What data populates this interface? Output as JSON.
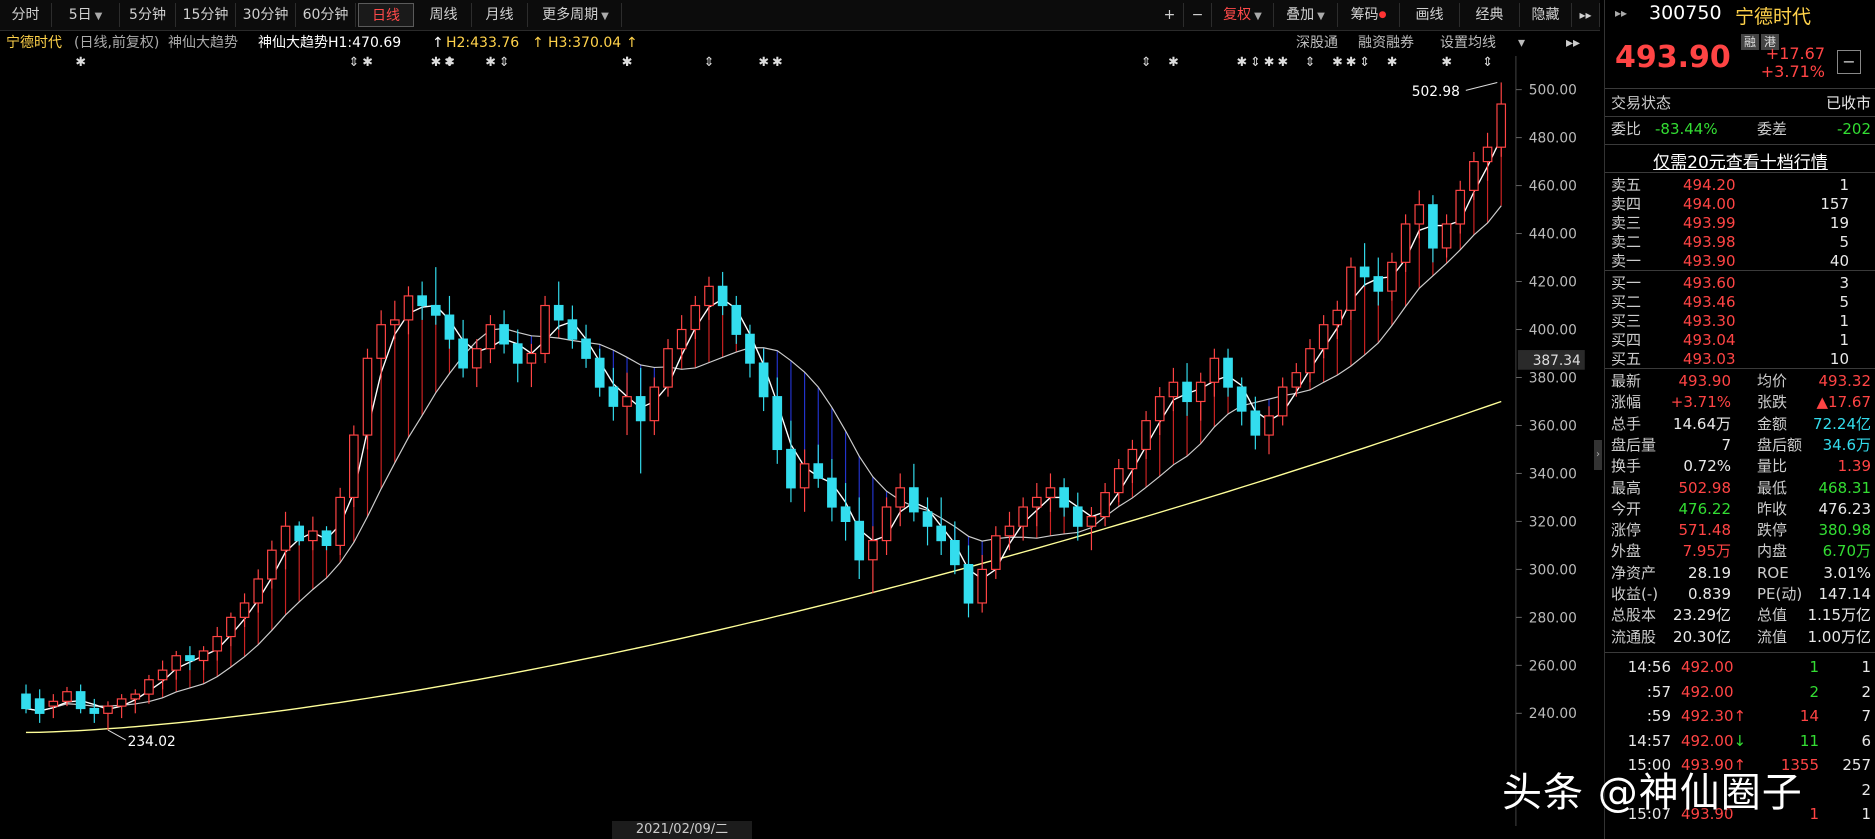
{
  "toolbar": {
    "periods": [
      "分时",
      "5日",
      "5分钟",
      "15分钟",
      "30分钟",
      "60分钟",
      "日线",
      "周线",
      "月线",
      "更多周期"
    ],
    "active_period": "日线",
    "right_buttons": [
      "+",
      "−",
      "复权",
      "叠加",
      "筹码",
      "画线",
      "经典",
      "隐藏"
    ]
  },
  "infobar": {
    "stock_name": "宁德时代",
    "mode": "(日线,前复权)",
    "indicator": "神仙大趋势",
    "h1_label": "神仙大趋势H1:470.69",
    "h2_label": "H2:433.76",
    "h3_label": "H3:370.04",
    "links": [
      "深股通",
      "融资融券",
      "设置均线"
    ]
  },
  "chart": {
    "y_ticks": [
      500.0,
      480.0,
      460.0,
      440.0,
      420.0,
      400.0,
      380.0,
      360.0,
      340.0,
      320.0,
      300.0,
      280.0,
      260.0,
      240.0
    ],
    "current_price_label": "387.34",
    "high_marker": "502.98",
    "low_marker": "234.02",
    "date_label": "2021/02/09/二",
    "colors": {
      "up": "#ff4444",
      "down": "#33ddee",
      "h2": "#ffffff",
      "h3": "#ffff99",
      "band_up": "#cc2222",
      "band_down": "#2233cc"
    }
  },
  "chart_data": {
    "type": "candlestick",
    "ylim": [
      225,
      505
    ],
    "ohlc": [
      [
        248,
        252,
        240,
        242
      ],
      [
        246,
        250,
        236,
        240
      ],
      [
        243,
        248,
        238,
        245
      ],
      [
        245,
        251,
        243,
        249
      ],
      [
        249,
        252,
        240,
        242
      ],
      [
        242,
        246,
        236,
        240
      ],
      [
        240,
        245,
        233,
        243
      ],
      [
        243,
        248,
        238,
        246
      ],
      [
        246,
        250,
        240,
        248
      ],
      [
        248,
        256,
        244,
        254
      ],
      [
        254,
        262,
        250,
        258
      ],
      [
        258,
        266,
        254,
        264
      ],
      [
        264,
        268,
        258,
        262
      ],
      [
        262,
        268,
        258,
        266
      ],
      [
        266,
        276,
        262,
        272
      ],
      [
        272,
        282,
        268,
        280
      ],
      [
        280,
        290,
        276,
        286
      ],
      [
        286,
        300,
        282,
        296
      ],
      [
        296,
        312,
        292,
        308
      ],
      [
        308,
        324,
        300,
        318
      ],
      [
        318,
        320,
        310,
        312
      ],
      [
        312,
        322,
        308,
        316
      ],
      [
        316,
        318,
        308,
        310
      ],
      [
        310,
        334,
        306,
        330
      ],
      [
        330,
        360,
        326,
        356
      ],
      [
        356,
        392,
        350,
        388
      ],
      [
        388,
        408,
        380,
        402
      ],
      [
        402,
        412,
        396,
        404
      ],
      [
        404,
        418,
        398,
        414
      ],
      [
        414,
        420,
        404,
        410
      ],
      [
        410,
        426,
        402,
        406
      ],
      [
        406,
        414,
        392,
        396
      ],
      [
        396,
        404,
        380,
        384
      ],
      [
        384,
        396,
        376,
        392
      ],
      [
        392,
        406,
        386,
        402
      ],
      [
        402,
        408,
        390,
        394
      ],
      [
        394,
        400,
        378,
        386
      ],
      [
        386,
        394,
        376,
        390
      ],
      [
        390,
        414,
        386,
        410
      ],
      [
        410,
        420,
        400,
        404
      ],
      [
        404,
        410,
        392,
        396
      ],
      [
        396,
        402,
        384,
        388
      ],
      [
        388,
        392,
        372,
        376
      ],
      [
        376,
        384,
        362,
        368
      ],
      [
        368,
        382,
        356,
        372
      ],
      [
        372,
        384,
        340,
        362
      ],
      [
        362,
        380,
        356,
        376
      ],
      [
        376,
        396,
        372,
        392
      ],
      [
        392,
        406,
        388,
        400
      ],
      [
        400,
        414,
        396,
        410
      ],
      [
        410,
        422,
        404,
        418
      ],
      [
        418,
        424,
        406,
        410
      ],
      [
        410,
        414,
        394,
        398
      ],
      [
        398,
        402,
        380,
        386
      ],
      [
        386,
        392,
        366,
        372
      ],
      [
        372,
        380,
        344,
        350
      ],
      [
        350,
        362,
        328,
        334
      ],
      [
        334,
        350,
        324,
        344
      ],
      [
        344,
        352,
        334,
        338
      ],
      [
        338,
        346,
        320,
        326
      ],
      [
        326,
        336,
        312,
        320
      ],
      [
        320,
        330,
        296,
        304
      ],
      [
        304,
        318,
        290,
        312
      ],
      [
        312,
        330,
        306,
        326
      ],
      [
        326,
        340,
        318,
        334
      ],
      [
        334,
        344,
        320,
        324
      ],
      [
        324,
        330,
        310,
        318
      ],
      [
        318,
        330,
        306,
        312
      ],
      [
        312,
        320,
        298,
        302
      ],
      [
        302,
        310,
        280,
        286
      ],
      [
        286,
        306,
        282,
        300
      ],
      [
        300,
        318,
        296,
        314
      ],
      [
        314,
        324,
        308,
        318
      ],
      [
        318,
        330,
        312,
        326
      ],
      [
        326,
        336,
        318,
        330
      ],
      [
        330,
        340,
        324,
        334
      ],
      [
        334,
        338,
        322,
        326
      ],
      [
        326,
        332,
        312,
        318
      ],
      [
        318,
        326,
        308,
        322
      ],
      [
        322,
        336,
        318,
        332
      ],
      [
        332,
        346,
        328,
        342
      ],
      [
        342,
        354,
        336,
        350
      ],
      [
        350,
        366,
        346,
        362
      ],
      [
        362,
        376,
        356,
        372
      ],
      [
        372,
        384,
        366,
        378
      ],
      [
        378,
        386,
        364,
        370
      ],
      [
        370,
        382,
        362,
        378
      ],
      [
        378,
        392,
        372,
        388
      ],
      [
        388,
        392,
        372,
        376
      ],
      [
        376,
        380,
        360,
        366
      ],
      [
        366,
        372,
        350,
        356
      ],
      [
        356,
        368,
        348,
        364
      ],
      [
        364,
        380,
        360,
        376
      ],
      [
        376,
        386,
        372,
        382
      ],
      [
        382,
        396,
        378,
        392
      ],
      [
        392,
        406,
        388,
        402
      ],
      [
        402,
        412,
        396,
        408
      ],
      [
        408,
        430,
        404,
        426
      ],
      [
        426,
        436,
        418,
        422
      ],
      [
        422,
        430,
        410,
        416
      ],
      [
        416,
        432,
        412,
        428
      ],
      [
        428,
        448,
        424,
        444
      ],
      [
        444,
        458,
        438,
        452
      ],
      [
        452,
        456,
        428,
        434
      ],
      [
        434,
        448,
        430,
        444
      ],
      [
        444,
        462,
        440,
        458
      ],
      [
        458,
        474,
        454,
        470
      ],
      [
        470,
        482,
        462,
        476
      ],
      [
        476,
        503,
        472,
        494
      ]
    ]
  },
  "panel": {
    "code": "300750",
    "name": "宁德时代",
    "price": "493.90",
    "badges": [
      "融",
      "港"
    ],
    "change": "+17.67",
    "change_pct": "+3.71%",
    "status_label": "交易状态",
    "status_value": "已收市",
    "weibi_label": "委比",
    "weibi_value": "-83.44%",
    "weicha_label": "委差",
    "weicha_value": "-202",
    "promo": "仅需20元查看十档行情",
    "sells": [
      {
        "label": "卖五",
        "price": "494.20",
        "vol": "1"
      },
      {
        "label": "卖四",
        "price": "494.00",
        "vol": "157"
      },
      {
        "label": "卖三",
        "price": "493.99",
        "vol": "19"
      },
      {
        "label": "卖二",
        "price": "493.98",
        "vol": "5"
      },
      {
        "label": "卖一",
        "price": "493.90",
        "vol": "40"
      }
    ],
    "buys": [
      {
        "label": "买一",
        "price": "493.60",
        "vol": "3"
      },
      {
        "label": "买二",
        "price": "493.46",
        "vol": "5"
      },
      {
        "label": "买三",
        "price": "493.30",
        "vol": "1"
      },
      {
        "label": "买四",
        "price": "493.04",
        "vol": "1"
      },
      {
        "label": "买五",
        "price": "493.03",
        "vol": "10"
      }
    ],
    "stats": [
      {
        "l1": "最新",
        "v1": "493.90",
        "c1": "r",
        "l2": "均价",
        "v2": "493.32",
        "c2": "r"
      },
      {
        "l1": "涨幅",
        "v1": "+3.71%",
        "c1": "r",
        "l2": "张跌",
        "v2": "▲17.67",
        "c2": "r"
      },
      {
        "l1": "总手",
        "v1": "14.64万",
        "c1": "w",
        "l2": "金额",
        "v2": "72.24亿",
        "c2": "c"
      },
      {
        "l1": "盘后量",
        "v1": "7",
        "c1": "w",
        "l2": "盘后额",
        "v2": "34.6万",
        "c2": "c"
      },
      {
        "l1": "换手",
        "v1": "0.72%",
        "c1": "w",
        "l2": "量比",
        "v2": "1.39",
        "c2": "r"
      },
      {
        "l1": "最高",
        "v1": "502.98",
        "c1": "r",
        "l2": "最低",
        "v2": "468.31",
        "c2": "g"
      },
      {
        "l1": "今开",
        "v1": "476.22",
        "c1": "g",
        "l2": "昨收",
        "v2": "476.23",
        "c2": "w"
      },
      {
        "l1": "涨停",
        "v1": "571.48",
        "c1": "r",
        "l2": "跌停",
        "v2": "380.98",
        "c2": "g"
      },
      {
        "l1": "外盘",
        "v1": "7.95万",
        "c1": "r",
        "l2": "内盘",
        "v2": "6.70万",
        "c2": "g"
      },
      {
        "l1": "净资产",
        "v1": "28.19",
        "c1": "w",
        "l2": "ROE",
        "v2": "3.01%",
        "c2": "w"
      },
      {
        "l1": "收益(-)",
        "v1": "0.839",
        "c1": "w",
        "l2": "PE(动)",
        "v2": "147.14",
        "c2": "w"
      },
      {
        "l1": "总股本",
        "v1": "23.29亿",
        "c1": "w",
        "l2": "总值",
        "v2": "1.15万亿",
        "c2": "w"
      },
      {
        "l1": "流通股",
        "v1": "20.30亿",
        "c1": "w",
        "l2": "流值",
        "v2": "1.00万亿",
        "c2": "w"
      }
    ],
    "ticks": [
      {
        "time": "14:56",
        "price": "492.00",
        "arrow": "",
        "vol": "1",
        "vc": "g",
        "n": "1"
      },
      {
        "time": ":57",
        "price": "492.00",
        "arrow": "",
        "vol": "2",
        "vc": "g",
        "n": "2"
      },
      {
        "time": ":59",
        "price": "492.30",
        "arrow": "↑",
        "vol": "14",
        "vc": "r",
        "n": "7"
      },
      {
        "time": "14:57",
        "price": "492.00",
        "arrow": "↓",
        "vol": "11",
        "vc": "g",
        "n": "6"
      },
      {
        "time": "15:00",
        "price": "493.90",
        "arrow": "↑",
        "vol": "1355",
        "vc": "r",
        "n": "257"
      },
      {
        "time": "",
        "price": "",
        "arrow": "",
        "vol": "",
        "vc": "g",
        "n": "2"
      },
      {
        "time": "15:07",
        "price": "493.90",
        "arrow": "",
        "vol": "1",
        "vc": "r",
        "n": "1"
      }
    ]
  },
  "watermark": "头条 @神仙圈子"
}
